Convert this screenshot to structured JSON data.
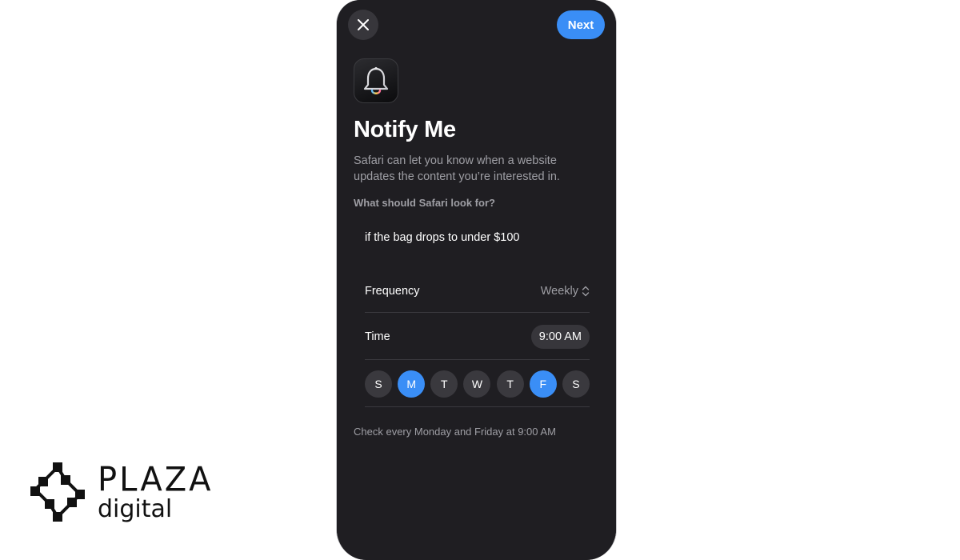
{
  "header": {
    "next_label": "Next"
  },
  "content": {
    "title": "Notify Me",
    "description": "Safari can let you know when a website updates the content you’re interested in.",
    "question": "What should Safari look for?",
    "query": "if the bag drops to under $100"
  },
  "settings": {
    "frequency_label": "Frequency",
    "frequency_value": "Weekly",
    "time_label": "Time",
    "time_value": "9:00 AM"
  },
  "days": [
    {
      "label": "S",
      "selected": false
    },
    {
      "label": "M",
      "selected": true
    },
    {
      "label": "T",
      "selected": false
    },
    {
      "label": "W",
      "selected": false
    },
    {
      "label": "T",
      "selected": false
    },
    {
      "label": "F",
      "selected": true
    },
    {
      "label": "S",
      "selected": false
    }
  ],
  "summary": "Check every Monday and Friday at 9:00 AM",
  "logo": {
    "line1": "PLAZA",
    "line2": "digital"
  },
  "colors": {
    "accent": "#3a8ef6",
    "background": "#1f1e22"
  },
  "icons": {
    "close": "close-icon",
    "app": "bell-icon",
    "frequency": "chevron-up-down-icon"
  }
}
